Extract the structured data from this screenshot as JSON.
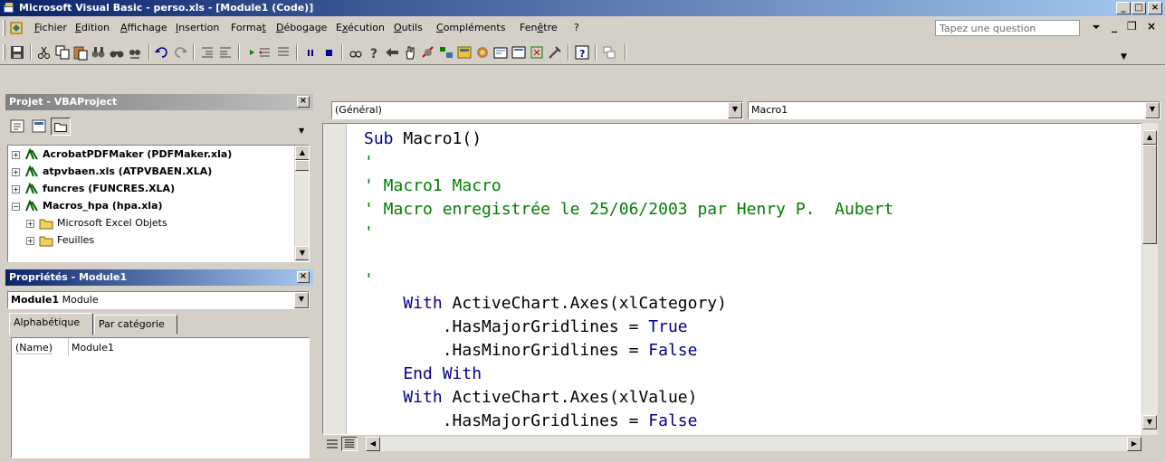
{
  "window": {
    "title": "Microsoft Visual Basic - perso.xls - [Module1 (Code)]",
    "minimize": "_",
    "maximize": "□",
    "close": "×"
  },
  "menu": {
    "items": [
      "Fichier",
      "Edition",
      "Affichage",
      "Insertion",
      "Format",
      "Débogage",
      "Exécution",
      "Outils",
      "Compléments",
      "Fenêtre",
      "?"
    ],
    "question_placeholder": "Tapez une question",
    "mdi_min": "_",
    "mdi_restore": "❐",
    "mdi_close": "×"
  },
  "project": {
    "title": "Projet - VBAProject",
    "close": "×",
    "tree": [
      {
        "label": "AcrobatPDFMaker (PDFMaker.xla)",
        "expander": "+",
        "bold": true
      },
      {
        "label": "atpvbaen.xls (ATPVBAEN.XLA)",
        "expander": "+",
        "bold": true
      },
      {
        "label": "funcres (FUNCRES.XLA)",
        "expander": "+",
        "bold": true
      },
      {
        "label": "Macros_hpa (hpa.xla)",
        "expander": "−",
        "bold": true
      },
      {
        "label": "Microsoft Excel Objets",
        "expander": "+",
        "bold": false
      },
      {
        "label": "Feuilles",
        "expander": "+",
        "bold": false
      }
    ]
  },
  "properties": {
    "title": "Propriétés - Module1",
    "close": "×",
    "object_name": "Module1",
    "object_type": "Module",
    "tabs": [
      "Alphabétique",
      "Par catégorie"
    ],
    "name_key": "(Name)",
    "name_value": "Module1"
  },
  "code": {
    "object_combo": "(Général)",
    "proc_combo": "Macro1",
    "lines": [
      [
        {
          "t": "Sub ",
          "c": "kw"
        },
        {
          "t": "Macro1()",
          "c": "pl"
        }
      ],
      [
        {
          "t": "'",
          "c": "cm"
        }
      ],
      [
        {
          "t": "' Macro1 Macro",
          "c": "cm"
        }
      ],
      [
        {
          "t": "' Macro enregistrée le 25/06/2003 par Henry P.  Aubert",
          "c": "cm"
        }
      ],
      [
        {
          "t": "'",
          "c": "cm"
        }
      ],
      [],
      [
        {
          "t": "'",
          "c": "cm"
        }
      ],
      [
        {
          "t": "    With ",
          "c": "kw"
        },
        {
          "t": "ActiveChart.Axes(xlCategory)",
          "c": "pl"
        }
      ],
      [
        {
          "t": "        .HasMajorGridlines = ",
          "c": "pl"
        },
        {
          "t": "True",
          "c": "kw"
        }
      ],
      [
        {
          "t": "        .HasMinorGridlines = ",
          "c": "pl"
        },
        {
          "t": "False",
          "c": "kw"
        }
      ],
      [
        {
          "t": "    End With",
          "c": "kw"
        }
      ],
      [
        {
          "t": "    With ",
          "c": "kw"
        },
        {
          "t": "ActiveChart.Axes(xlValue)",
          "c": "pl"
        }
      ],
      [
        {
          "t": "        .HasMajorGridlines = ",
          "c": "pl"
        },
        {
          "t": "False",
          "c": "kw"
        }
      ]
    ]
  },
  "colors": {
    "keyword": "#00008b",
    "comment": "#008000",
    "title_active": "#0a246a"
  }
}
